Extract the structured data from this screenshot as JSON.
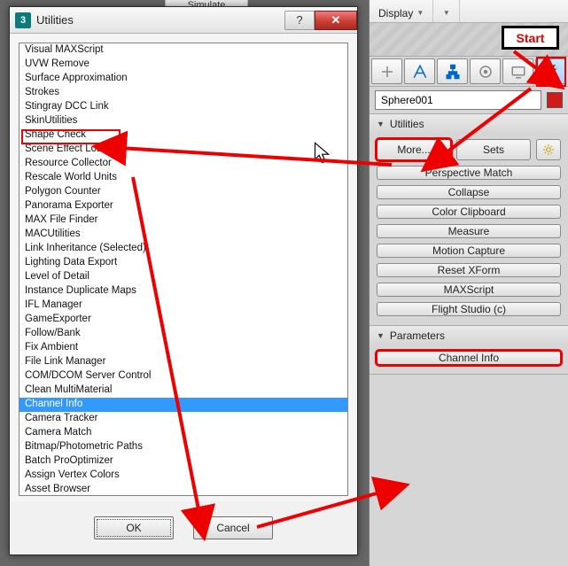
{
  "dialog": {
    "title": "Utilities",
    "help_symbol": "?",
    "close_symbol": "✕",
    "ok_label": "OK",
    "cancel_label": "Cancel",
    "list_items": [
      "Asset Browser",
      "Assign Vertex Colors",
      "Batch ProOptimizer",
      "Bitmap/Photometric Paths",
      "Camera Match",
      "Camera Tracker",
      "Channel Info",
      "Clean MultiMaterial",
      "COM/DCOM Server Control",
      "File Link Manager",
      "Fix Ambient",
      "Follow/Bank",
      "GameExporter",
      "IFL Manager",
      "Instance Duplicate Maps",
      "Level of Detail",
      "Lighting Data Export",
      "Link Inheritance (Selected)",
      "MACUtilities",
      "MAX File Finder",
      "Panorama Exporter",
      "Polygon Counter",
      "Rescale World Units",
      "Resource Collector",
      "Scene Effect Loader",
      "Shape Check",
      "SkinUtilities",
      "Stingray DCC Link",
      "Strokes",
      "Surface Approximation",
      "UVW Remove",
      "Visual MAXScript"
    ],
    "selected_index": 6
  },
  "menu": {
    "display_label": "Display",
    "simulate_label": "Simulate"
  },
  "start_label": "Start",
  "tabs": {
    "names": [
      "create-tab",
      "modify-tab",
      "hierarchy-tab",
      "motion-tab",
      "display-tab",
      "utilities-tab"
    ]
  },
  "object": {
    "name": "Sphere001"
  },
  "rollouts": {
    "utilities_title": "Utilities",
    "more_label": "More...",
    "sets_label": "Sets",
    "buttons": [
      "Perspective Match",
      "Collapse",
      "Color Clipboard",
      "Measure",
      "Motion Capture",
      "Reset XForm",
      "MAXScript",
      "Flight Studio (c)"
    ],
    "parameters_title": "Parameters",
    "channel_info_label": "Channel Info"
  }
}
